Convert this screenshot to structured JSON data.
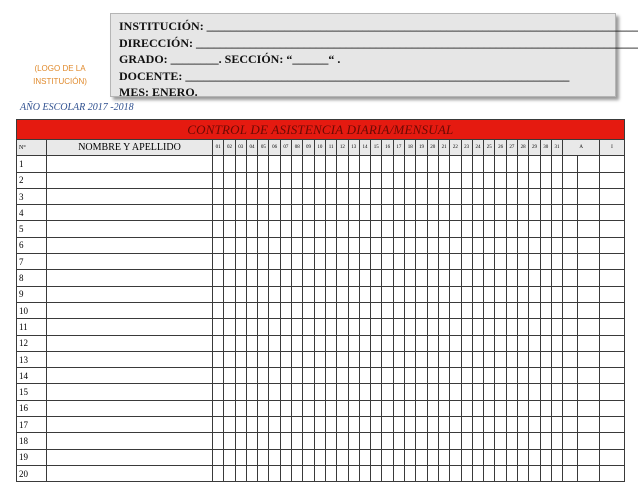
{
  "logo_text": [
    "(LOGO DE LA",
    "INSTITUCIÓN)"
  ],
  "info_lines": [
    "INSTITUCIÓN: _____________________________________________________________________________",
    "DIRECCIÓN: ______________________________________________________________________________",
    "GRADO: ________. SECCIÓN:  “______“  .",
    "DOCENTE: ________________________________________________________________",
    "MES: ENERO."
  ],
  "school_year": "AÑO ESCOLAR 2017 -2018",
  "table": {
    "title": "CONTROL DE ASISTENCIA DIARIA/MENSUAL",
    "number_header": "N°",
    "name_header": "NOMBRE Y APELLIDO",
    "day_headers": [
      "01",
      "02",
      "03",
      "04",
      "05",
      "06",
      "07",
      "08",
      "09",
      "10",
      "11",
      "12",
      "13",
      "14",
      "15",
      "16",
      "17",
      "18",
      "19",
      "20",
      "21",
      "22",
      "23",
      "24",
      "25",
      "26",
      "27",
      "28",
      "29",
      "30",
      "31"
    ],
    "total_headers": [
      "A",
      "I"
    ],
    "row_numbers": [
      "1",
      "2",
      "3",
      "4",
      "5",
      "6",
      "7",
      "8",
      "9",
      "10",
      "11",
      "12",
      "13",
      "14",
      "15",
      "16",
      "17",
      "18",
      "19",
      "20"
    ]
  },
  "colors": {
    "title_bg": "#e51a10",
    "header_bg": "#e9e9e9",
    "logo_text": "#e08a2c",
    "year_text": "#2e4f8f"
  }
}
